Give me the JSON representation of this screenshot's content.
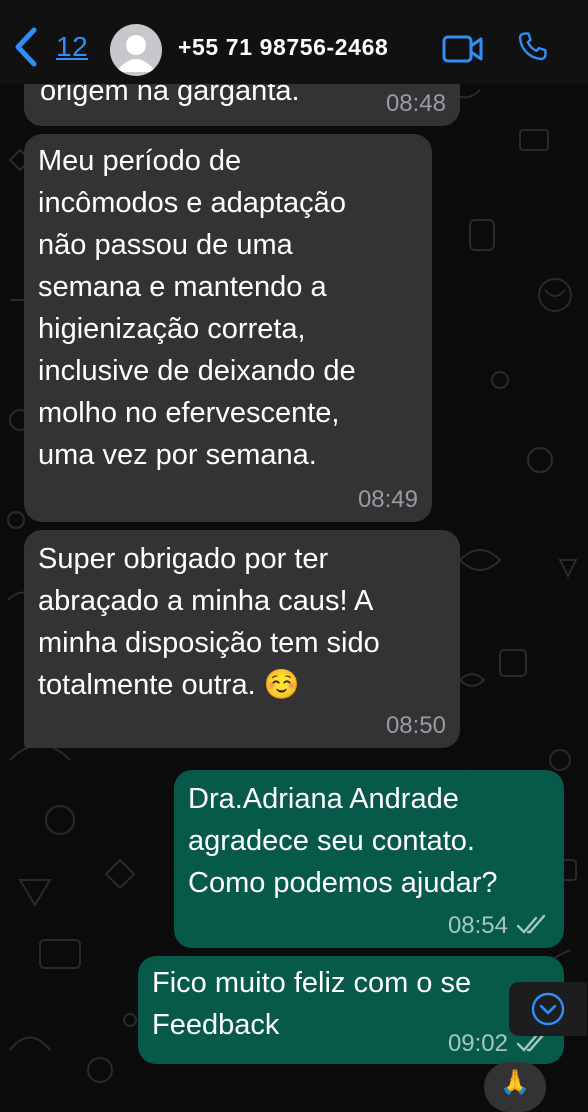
{
  "header": {
    "back_count": "12",
    "contact_name": "+55 71 98756-2468"
  },
  "messages": [
    {
      "id": "m0",
      "direction": "incoming",
      "text": "origem na garganta.",
      "time": "08:48"
    },
    {
      "id": "m1",
      "direction": "incoming",
      "text": "Meu período de\nincômodos e adaptação\nnão passou de uma\nsemana e mantendo a\nhigienização correta,\ninclusive de deixando de\nmolho no efervescente,\numa vez por semana.",
      "time": "08:49"
    },
    {
      "id": "m2",
      "direction": "incoming",
      "text": "Super obrigado por ter\nabraçado a minha caus! A\nminha disposição tem sido\ntotalmente outra. ☺️",
      "time": "08:50"
    },
    {
      "id": "m3",
      "direction": "outgoing",
      "text": "Dra.Adriana Andrade\nagradece seu contato.\nComo podemos ajudar?",
      "time": "08:54",
      "status": "read"
    },
    {
      "id": "m4",
      "direction": "outgoing",
      "text": "Fico muito feliz com o se\nFeedback",
      "time": "09:02",
      "status": "read"
    }
  ],
  "reaction": "🙏",
  "icons": {
    "back": "chevron-left-icon",
    "avatar": "person-icon",
    "video": "video-camera-icon",
    "call": "phone-icon",
    "scroll": "chevron-down-circle-icon",
    "ticks": "double-check-icon"
  },
  "colors": {
    "accent": "#2f8ef7",
    "incoming_bubble": "#333335",
    "outgoing_bubble": "#075a49",
    "background": "#0b0b0b"
  }
}
